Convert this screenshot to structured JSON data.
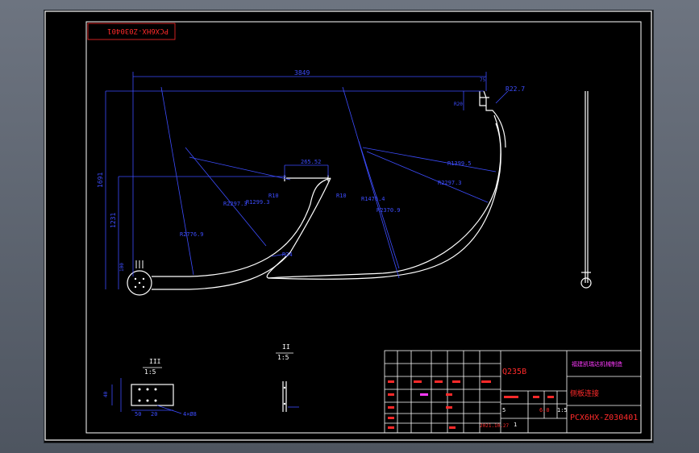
{
  "drawing": {
    "stamp_code": "PCX6HX-Z030401",
    "dimensions": {
      "overall_length": "3849",
      "top_small": "75",
      "r_top": "R22.7",
      "tube_width": "R20",
      "total_height": "1691",
      "mid_width": "265.52",
      "r_small_left": "R10",
      "r_small_right": "R10",
      "left_height": "1231",
      "base_offset": "100",
      "r_large_left_a": "R2297.3",
      "r_large_left_b": "R1299.3",
      "r_large_left_c": "R2776.9",
      "r_mid_a": "R1476.4",
      "r_mid_b": "R2370.9",
      "r_right_a": "R1399.5",
      "r_right_b": "R2297.3",
      "r_inner": "R24"
    },
    "view_labels": {
      "section_iii": "III",
      "scale_iii": "1:5",
      "section_ii": "II",
      "scale_ii": "1:5",
      "detail_note": "4×Ø8",
      "detail_dim_a": "50",
      "detail_dim_b": "20",
      "detail_dim_c": "40"
    },
    "title_block": {
      "material": "Q235B",
      "company": "福建凯瑞达机械制造",
      "part_name": "侧板连接",
      "drawing_code": "PCX6HX-Z030401",
      "scale_label_a": "1:5",
      "weight": "6.0",
      "sheet_no": "1",
      "date": "2021.10.27",
      "small_note": "5"
    }
  },
  "colors": {
    "background": "#000000",
    "geometry": "#ffffff",
    "dimension": "#3d4dff",
    "title_text": "#ff2a2a",
    "frame": "#ffffff"
  }
}
